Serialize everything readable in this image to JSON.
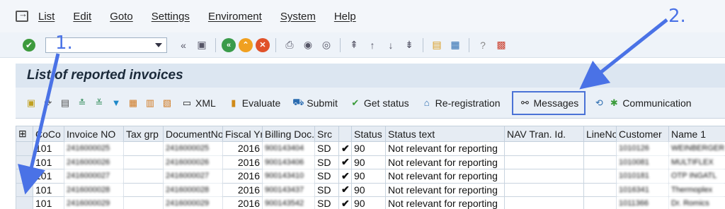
{
  "menu": [
    "List",
    "Edit",
    "Goto",
    "Settings",
    "Enviroment",
    "System",
    "Help"
  ],
  "title": "List of reported invoices",
  "app_toolbar": {
    "xml": "XML",
    "evaluate": "Evaluate",
    "submit": "Submit",
    "get_status": "Get status",
    "re_registration": "Re-registration",
    "messages": "Messages",
    "communication": "Communication"
  },
  "columns": [
    "CoCo",
    "Invoice NO",
    "Tax grp",
    "DocumentNo",
    "Fiscal Yr",
    "Billing Doc.",
    "Src",
    "",
    "Status",
    "Status text",
    "NAV Tran. Id.",
    "LineNo",
    "Customer",
    "Name 1"
  ],
  "rows": [
    {
      "coco": "101",
      "invoice": "2416000025",
      "taxgrp": "",
      "docno": "2416000025",
      "fiscal": "2016",
      "billing": "900143404",
      "src": "SD",
      "status": "90",
      "status_text": "Not relevant for reporting",
      "nav": "",
      "lineno": "",
      "customer": "1010126",
      "name": "WEINBERGER"
    },
    {
      "coco": "101",
      "invoice": "2416000026",
      "taxgrp": "",
      "docno": "2416000026",
      "fiscal": "2016",
      "billing": "900143406",
      "src": "SD",
      "status": "90",
      "status_text": "Not relevant for reporting",
      "nav": "",
      "lineno": "",
      "customer": "1010081",
      "name": "MULTIFLEX"
    },
    {
      "coco": "101",
      "invoice": "2416000027",
      "taxgrp": "",
      "docno": "2416000027",
      "fiscal": "2016",
      "billing": "900143410",
      "src": "SD",
      "status": "90",
      "status_text": "Not relevant for reporting",
      "nav": "",
      "lineno": "",
      "customer": "1010181",
      "name": "OTP INGATL"
    },
    {
      "coco": "101",
      "invoice": "2416000028",
      "taxgrp": "",
      "docno": "2416000028",
      "fiscal": "2016",
      "billing": "900143437",
      "src": "SD",
      "status": "90",
      "status_text": "Not relevant for reporting",
      "nav": "",
      "lineno": "",
      "customer": "1016341",
      "name": "Thermoplex"
    },
    {
      "coco": "101",
      "invoice": "2416000029",
      "taxgrp": "",
      "docno": "2416000029",
      "fiscal": "2016",
      "billing": "900143542",
      "src": "SD",
      "status": "90",
      "status_text": "Not relevant for reporting",
      "nav": "",
      "lineno": "",
      "customer": "1011366",
      "name": "Dr. Romics"
    }
  ],
  "annotations": {
    "one": "1.",
    "two": "2."
  },
  "colors": {
    "accent": "#4a72e6",
    "title_bg": "#dce6f1",
    "ok_green": "#3d9a3d"
  }
}
